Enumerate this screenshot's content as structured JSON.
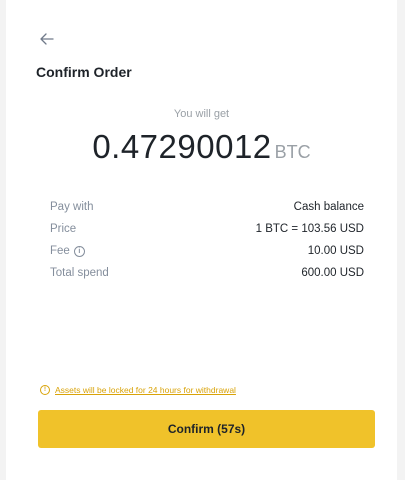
{
  "header": {
    "back_icon": "arrow-left-icon",
    "title": "Confirm Order"
  },
  "summary": {
    "get_label": "You will get",
    "amount": "0.47290012",
    "unit": "BTC"
  },
  "details": [
    {
      "label": "Pay with",
      "value": "Cash balance"
    },
    {
      "label": "Price",
      "value": "1 BTC = 103.56 USD"
    },
    {
      "label": "Fee",
      "value": "10.00 USD",
      "icon": "info-icon"
    },
    {
      "label": "Total spend",
      "value": "600.00 USD"
    }
  ],
  "notice": {
    "icon": "info-icon",
    "text": "Assets will be locked for 24 hours for withdrawal"
  },
  "confirm_button": {
    "label": "Confirm (57s)"
  },
  "colors": {
    "accent": "#f0c22a",
    "warning_text": "#d9a308",
    "primary_text": "#1e2329",
    "secondary_text": "#848e9c"
  }
}
